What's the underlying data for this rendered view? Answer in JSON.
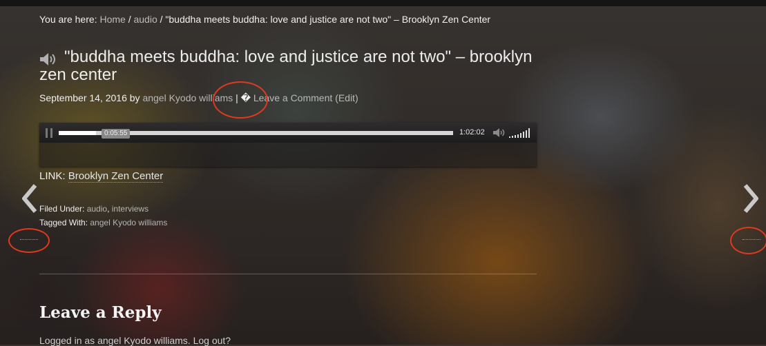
{
  "breadcrumb": {
    "prefix": "You are here: ",
    "home": "Home",
    "sep1": " / ",
    "section": "audio",
    "sep2": " / ",
    "current": "\"buddha meets buddha: love and justice are not two\" – Brooklyn Zen Center"
  },
  "post": {
    "title": "\"buddha meets buddha: love and justice are not two\" – brooklyn zen center",
    "date": "September 14, 2016",
    "by": " by ",
    "author": "angel Kyodo williams",
    "separator": " | ",
    "comment_glyph": "�",
    "leave_comment": "Leave a Comment",
    "edit": "(Edit)"
  },
  "player": {
    "hover_time": "0:05:55",
    "duration": "1:02:02",
    "progress_fraction": 0.095,
    "volume_level": "high"
  },
  "link": {
    "label": "LINK: ",
    "text": "Brooklyn Zen Center"
  },
  "taxonomy": {
    "filed_label": "Filed Under: ",
    "filed": [
      "audio",
      "interviews"
    ],
    "tagged_label": "Tagged With: ",
    "tagged": [
      "angel Kyodo williams"
    ]
  },
  "comments": {
    "title": "Leave a Reply",
    "logged_prefix": "Logged in as angel Kyodo williams. ",
    "logout": "Log out?"
  },
  "nav": {
    "prev_glyph": "❮",
    "next_glyph": "❯"
  },
  "colors": {
    "callout": "#e03a1e"
  }
}
